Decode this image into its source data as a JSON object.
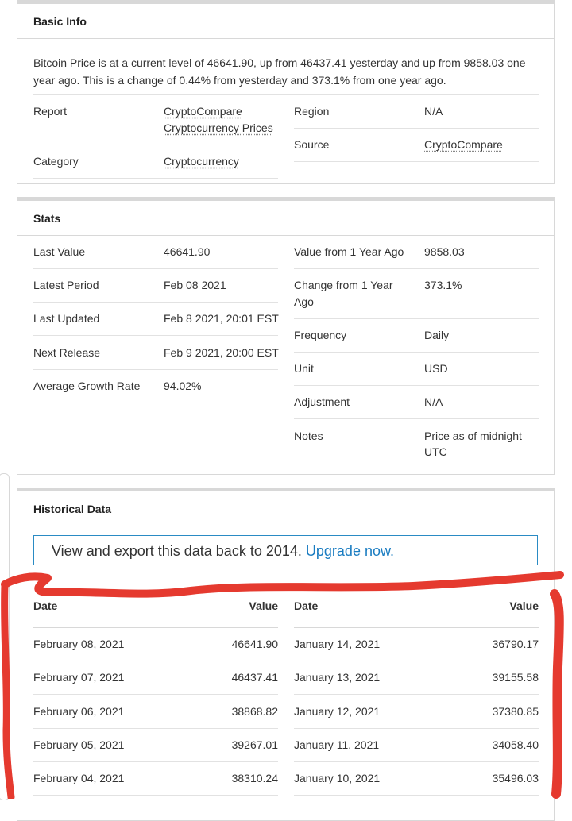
{
  "basic_info": {
    "title": "Basic Info",
    "description": "Bitcoin Price is at a current level of 46641.90, up from 46437.41 yesterday and up from 9858.03 one year ago. This is a change of 0.44% from yesterday and 373.1% from one year ago.",
    "report_label": "Report",
    "report_value_line1": "CryptoCompare",
    "report_value_line2": "Cryptocurrency Prices",
    "category_label": "Category",
    "category_value": "Cryptocurrency",
    "region_label": "Region",
    "region_value": "N/A",
    "source_label": "Source",
    "source_value": "CryptoCompare"
  },
  "stats": {
    "title": "Stats",
    "left": [
      {
        "label": "Last Value",
        "value": "46641.90"
      },
      {
        "label": "Latest Period",
        "value": "Feb 08 2021"
      },
      {
        "label": "Last Updated",
        "value": "Feb 8 2021, 20:01 EST"
      },
      {
        "label": "Next Release",
        "value": "Feb 9 2021, 20:00 EST"
      },
      {
        "label": "Average Growth Rate",
        "value": "94.02%"
      }
    ],
    "right": [
      {
        "label": "Value from 1 Year Ago",
        "value": "9858.03"
      },
      {
        "label": "Change from 1 Year",
        "label2": "Ago",
        "value": "373.1%"
      },
      {
        "label": "Frequency",
        "value": "Daily"
      },
      {
        "label": "Unit",
        "value": "USD"
      },
      {
        "label": "Adjustment",
        "value": "N/A"
      },
      {
        "label": "Notes",
        "value": "Price as of midnight",
        "value2": "UTC"
      }
    ]
  },
  "historical": {
    "title": "Historical Data",
    "banner_text": "View and export this data back to 2014.",
    "banner_link": "Upgrade now.",
    "col_date": "Date",
    "col_value": "Value",
    "left_rows": [
      {
        "date": "February 08, 2021",
        "value": "46641.90"
      },
      {
        "date": "February 07, 2021",
        "value": "46437.41"
      },
      {
        "date": "February 06, 2021",
        "value": "38868.82"
      },
      {
        "date": "February 05, 2021",
        "value": "39267.01"
      },
      {
        "date": "February 04, 2021",
        "value": "38310.24"
      }
    ],
    "right_rows": [
      {
        "date": "January 14, 2021",
        "value": "36790.17"
      },
      {
        "date": "January 13, 2021",
        "value": "39155.58"
      },
      {
        "date": "January 12, 2021",
        "value": "37380.85"
      },
      {
        "date": "January 11, 2021",
        "value": "34058.40"
      },
      {
        "date": "January 10, 2021",
        "value": "35496.03"
      }
    ]
  },
  "colors": {
    "annotation": "#e53a2f",
    "link_blue": "#1a7cc1",
    "border": "#d8d8d8"
  }
}
